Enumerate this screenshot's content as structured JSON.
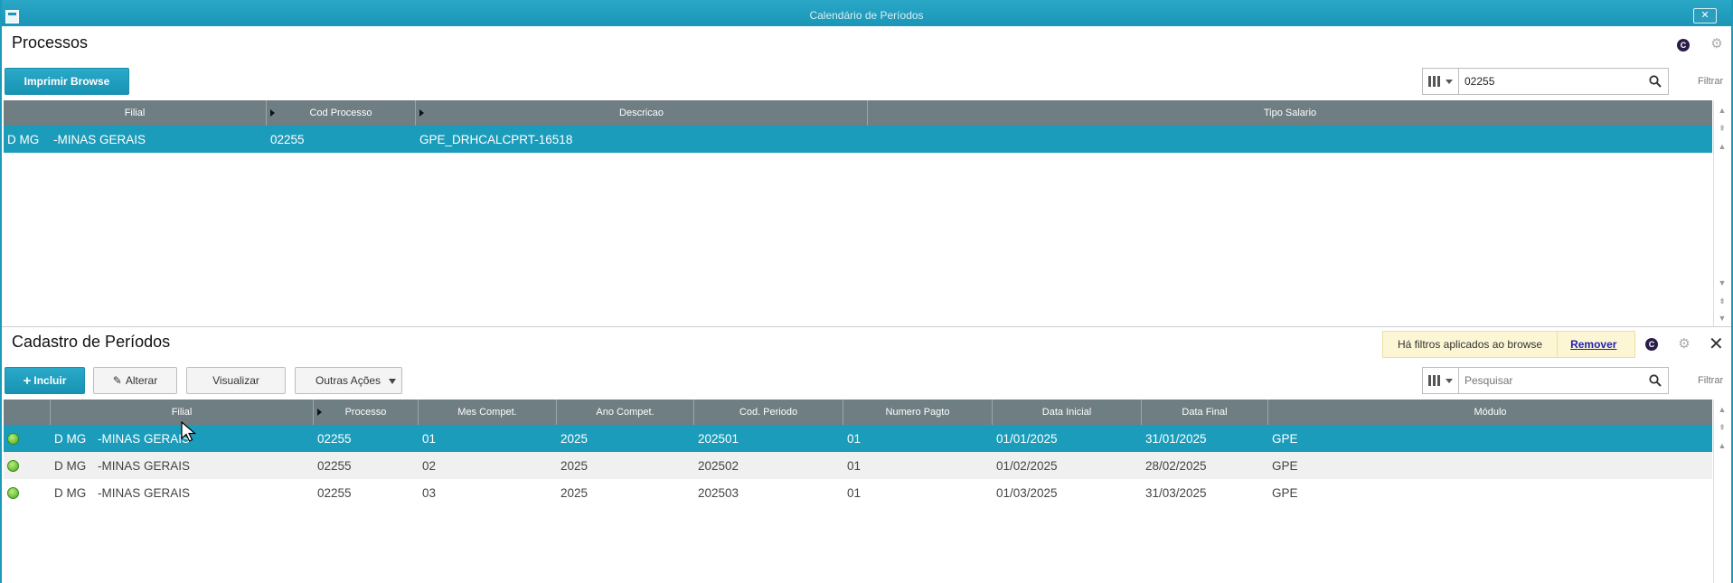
{
  "window": {
    "title": "Calendário de Períodos"
  },
  "processos": {
    "title": "Processos",
    "print_button": "Imprimir Browse",
    "search_value": "02255",
    "filter_label": "Filtrar",
    "columns": [
      "Filial",
      "Cod Processo",
      "Descricao",
      "Tipo Salario"
    ],
    "rows": [
      {
        "filial_code": "D MG",
        "filial_name": "-MINAS GERAIS",
        "cod_processo": "02255",
        "descricao": "GPE_DRHCALCPRT-16518",
        "tipo_salario": ""
      }
    ]
  },
  "periodos": {
    "title": "Cadastro de Períodos",
    "filter_banner": "Há filtros aplicados ao browse",
    "remove_link": "Remover",
    "buttons": {
      "incluir": "Incluir",
      "alterar": "Alterar",
      "visualizar": "Visualizar",
      "outras": "Outras Ações"
    },
    "search_placeholder": "Pesquisar",
    "filter_label": "Filtrar",
    "columns": [
      "Filial",
      "Processo",
      "Mes Compet.",
      "Ano Compet.",
      "Cod. Periodo",
      "Numero Pagto",
      "Data Inicial",
      "Data Final",
      "Módulo"
    ],
    "rows": [
      {
        "filial_code": "D MG",
        "filial_name": "-MINAS GERAIS",
        "processo": "02255",
        "mes": "01",
        "ano": "2025",
        "cod_periodo": "202501",
        "numero_pagto": "01",
        "data_inicial": "01/01/2025",
        "data_final": "31/01/2025",
        "modulo": "GPE"
      },
      {
        "filial_code": "D MG",
        "filial_name": "-MINAS GERAIS",
        "processo": "02255",
        "mes": "02",
        "ano": "2025",
        "cod_periodo": "202502",
        "numero_pagto": "01",
        "data_inicial": "01/02/2025",
        "data_final": "28/02/2025",
        "modulo": "GPE"
      },
      {
        "filial_code": "D MG",
        "filial_name": "-MINAS GERAIS",
        "processo": "02255",
        "mes": "03",
        "ano": "2025",
        "cod_periodo": "202503",
        "numero_pagto": "01",
        "data_inicial": "01/03/2025",
        "data_final": "31/03/2025",
        "modulo": "GPE"
      }
    ]
  },
  "icons": {
    "status": "status-green-icon",
    "help": "c-icon",
    "settings": "gear-icon",
    "close": "close-icon"
  },
  "colors": {
    "accent": "#1b9cbb",
    "header": "#6f7e83",
    "banner": "#fdf6d4",
    "status_ok": "#4aa521"
  }
}
